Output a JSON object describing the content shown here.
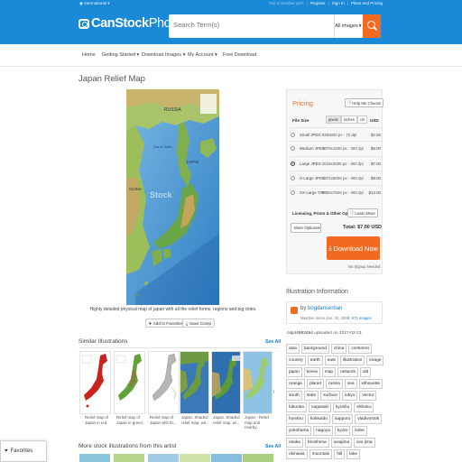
{
  "header": {
    "region": "International",
    "not_member": "Not a member yet?",
    "register": "Register",
    "signin": "Sign In",
    "plans": "Plans and Pricing",
    "logo_bold": "CanStock",
    "logo_light": "Photo",
    "search_placeholder": "Search Term(s)",
    "search_category": "All images",
    "accent_color": "#1a8ad8",
    "button_color": "#f26a21"
  },
  "nav": {
    "home": "Home",
    "getting_started": "Getting Started",
    "download_images": "Download Images",
    "my_account": "My Account",
    "free_download": "Free Download"
  },
  "page": {
    "title": "Japan Relief Map",
    "caption": "Highly detailed physical map of japan with all the relief forms, regions and big cities.",
    "add_favorites": "Add to Favorites",
    "save_comp": "Save Comp",
    "watermark": "Stock",
    "map_labels": {
      "russia": "RUSSIA",
      "japan": "JAPAN",
      "china": "CHINA",
      "sea": "Sea of Japan"
    }
  },
  "pricing": {
    "title": "Pricing",
    "help": "Help Me Choose",
    "file_size_label": "File Size",
    "units": [
      "pixels",
      "inches",
      "cm"
    ],
    "currency": "USD",
    "rows": [
      {
        "name": "Small JPEG",
        "dims": "539x800 px - 72 dpi",
        "price": "$2.50",
        "selected": false
      },
      {
        "name": "Medium JPEG",
        "dims": "1079x1600 px - 300 dpi",
        "price": "$6.00",
        "selected": false
      },
      {
        "name": "Large JPEG",
        "dims": "2023x3000 px - 300 dpi",
        "price": "$7.00",
        "selected": true
      },
      {
        "name": "X-Large JPEG",
        "dims": "3371x5000 px - 300 dpi",
        "price": "$8.00",
        "selected": false
      },
      {
        "name": "XX-Large TIFF",
        "dims": "5056x7500 px - 300 dpi",
        "price": "$12.00",
        "selected": false
      }
    ],
    "licensing": "Licensing, Prints & Other Options",
    "learn_more": "Learn More",
    "more_options": "More Options",
    "total": "Total: $7.00 USD",
    "download": "Download Now",
    "no_signup": "No Signup Needed"
  },
  "info": {
    "title": "Illustration Information",
    "by": "by",
    "author": "bogdanserban",
    "member_since": "Member since Jan. 20, 2008,",
    "images_count": "671 images",
    "item_id": "csp44983494",
    "uploaded": "uploaded on 2017-02-23.",
    "tags": [
      "asia",
      "background",
      "china",
      "continent",
      "country",
      "earth",
      "east",
      "illustration",
      "image",
      "japan",
      "korea",
      "map",
      "network",
      "old",
      "orange",
      "planet",
      "russia",
      "sea",
      "silhouette",
      "south",
      "state",
      "surface",
      "tokyo",
      "vector",
      "fukuoka",
      "nagasaki",
      "kyushu",
      "shikoku",
      "honshu",
      "hokkaido",
      "sapporo",
      "vladivostok",
      "yokohama",
      "nagoya",
      "kyoto",
      "kobe",
      "osaka",
      "hiroshima",
      "uwajima",
      "iwo jima",
      "okinawa",
      "mountain",
      "hill",
      "lake"
    ]
  },
  "similar": {
    "title": "Similar Illustrations",
    "see_all": "See All",
    "items": [
      {
        "caption": "Relief map of Japan in red."
      },
      {
        "caption": "Relief map of Japan in green."
      },
      {
        "caption": "Relief map of Japan with th..."
      },
      {
        "caption": "Japan. Shaded relief map, wit..."
      },
      {
        "caption": "Japan. Shaded relief map, wi..."
      },
      {
        "caption": "Japan - Relief map and nearby..."
      }
    ]
  },
  "more": {
    "title": "More stock illustrations from this artist",
    "see_all": "See All"
  },
  "favorites": {
    "label": "Favorites"
  }
}
